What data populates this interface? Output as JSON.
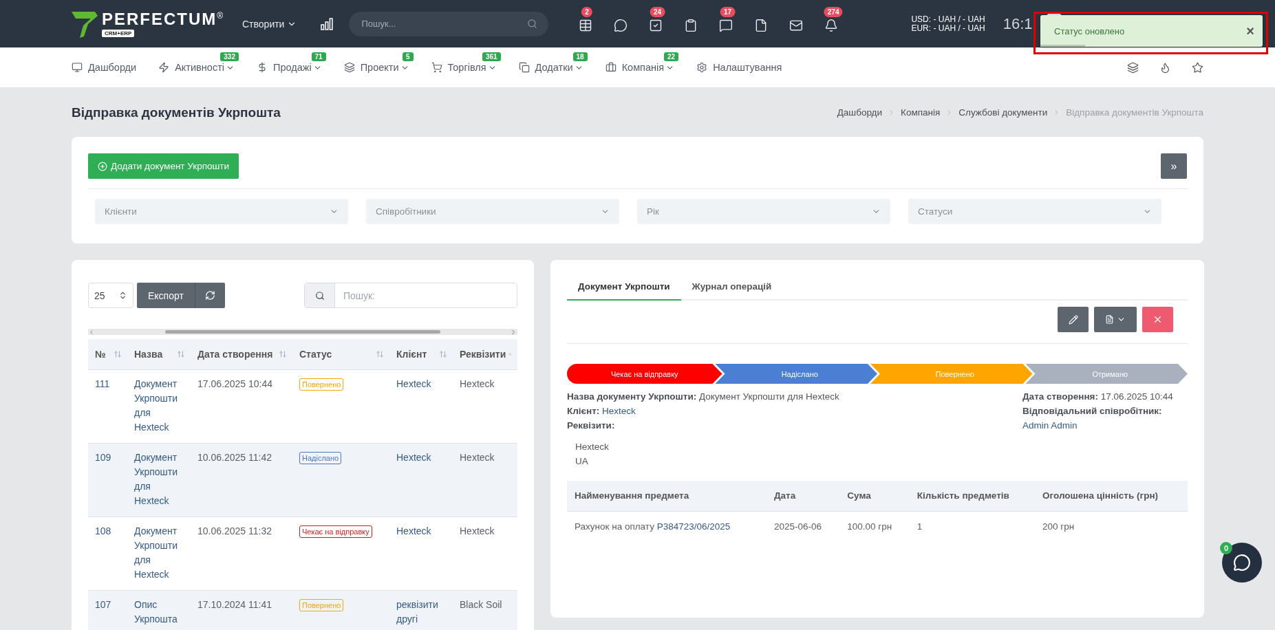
{
  "header": {
    "logo": {
      "name": "PERFECTUM",
      "mark": "®",
      "sub": "CRM+ERP"
    },
    "create": "Створити",
    "search": {
      "placeholder": "Пошук..."
    },
    "icons": [
      {
        "kind": "table",
        "badge": "2"
      },
      {
        "kind": "chat"
      },
      {
        "kind": "task",
        "badge": "24"
      },
      {
        "kind": "clipboard"
      },
      {
        "kind": "message",
        "badge": "17"
      },
      {
        "kind": "file"
      },
      {
        "kind": "mail"
      },
      {
        "kind": "bell",
        "badge": "274"
      }
    ],
    "currency": [
      "USD: - UAH / - UAH",
      "EUR: - UAH / - UAH"
    ],
    "time": "16:1"
  },
  "toast": {
    "text": "Статус оновлено",
    "close": "×",
    "level": 0.2
  },
  "nav": [
    {
      "kind": "monitor",
      "label": "Дашборди",
      "dropdown": false
    },
    {
      "kind": "zap",
      "label": "Активності",
      "badge": "332",
      "dropdown": true
    },
    {
      "kind": "dollar",
      "label": "Продажі",
      "badge": "71",
      "dropdown": true
    },
    {
      "kind": "layers",
      "label": "Проекти",
      "badge": "5",
      "dropdown": true
    },
    {
      "kind": "cart",
      "label": "Торгівля",
      "badge": "361",
      "dropdown": true
    },
    {
      "kind": "copy",
      "label": "Додатки",
      "badge": "18",
      "dropdown": true
    },
    {
      "kind": "briefcase",
      "label": "Компанія",
      "badge": "22",
      "dropdown": true
    },
    {
      "kind": "settings",
      "label": "Налаштування",
      "dropdown": false
    }
  ],
  "nav_right": [
    {
      "kind": "layers"
    },
    {
      "kind": "flame"
    },
    {
      "kind": "star"
    }
  ],
  "page_title": "Відправка документів Укрпошта",
  "breadcrumbs": [
    {
      "label": "Дашборди",
      "current": false
    },
    {
      "label": "Компанія",
      "current": false
    },
    {
      "label": "Службові документи",
      "current": false
    },
    {
      "label": "Відправка документів Укрпошта",
      "current": true
    }
  ],
  "add_button": "Додати документ Укрпошти",
  "expand_button": "»",
  "filters": [
    {
      "placeholder": "Клієнти"
    },
    {
      "placeholder": "Співробітники"
    },
    {
      "placeholder": "Рік"
    },
    {
      "placeholder": "Статуси"
    }
  ],
  "list": {
    "page_size": "25",
    "export": "Експорт",
    "search": {
      "placeholder": "Пошук:"
    },
    "columns": [
      "№",
      "Назва",
      "Дата створення",
      "Статус",
      "Клієнт",
      "Реквізити"
    ],
    "rows": [
      {
        "number": "111",
        "name": "Документ Укрпошти для Hexteck",
        "date": "17.06.2025 10:44",
        "status": "Повернено",
        "color": "#f6a609",
        "client": "Hexteck",
        "requisites": "Hexteck"
      },
      {
        "number": "109",
        "name": "Документ Укрпошти для Hexteck",
        "date": "10.06.2025 11:42",
        "status": "Надіслано",
        "color": "#4a78c2",
        "client": "Hexteck",
        "requisites": "Hexteck"
      },
      {
        "number": "108",
        "name": "Документ Укрпошти для Hexteck",
        "date": "10.06.2025 11:32",
        "status": "Чекає на відправку",
        "color": "#c81e1e",
        "client": "Hexteck",
        "requisites": "Hexteck"
      },
      {
        "number": "107",
        "name": "Опис Укрпошта",
        "date": "17.10.2024 11:41",
        "status": "Повернено",
        "color": "#f6a609",
        "client": "реквізити другі",
        "requisites": "Black Soil"
      }
    ]
  },
  "detail": {
    "tabs": [
      {
        "label": "Документ Укрпошти",
        "selected": true
      },
      {
        "label": "Журнал операцій",
        "selected": false
      }
    ],
    "steps": [
      {
        "label": "Чекає на відправку",
        "color": "#ff0000"
      },
      {
        "label": "Надіслано",
        "color": "#4a7fd4"
      },
      {
        "label": "Повернено",
        "color": "#ffa500"
      },
      {
        "label": "Отримано",
        "color": "#a9b1bf"
      }
    ],
    "fields_left": [
      {
        "label": "Назва документу Укрпошти:",
        "value": "Документ Укрпошти для Hexteck",
        "link": false
      },
      {
        "label": "Клієнт:",
        "value": "Hexteck",
        "link": true
      },
      {
        "label": "Реквізити:"
      }
    ],
    "requisites_lines": [
      "Hexteck",
      "UA"
    ],
    "created": {
      "label": "Дата створення:",
      "value": "17.06.2025 10:44"
    },
    "responsible": {
      "label": "Відповідальний співробітник:",
      "value": "Admin Admin"
    },
    "items_columns": [
      "Найменування предмета",
      "Дата",
      "Сума",
      "Кількість предметів",
      "Оголошена цінність (грн)"
    ],
    "items": [
      {
        "name": "Рахунок на оплату",
        "link": "Р384723/06/2025",
        "date": "2025-06-06",
        "sum": "100.00 грн",
        "count": "1",
        "value": "200 грн"
      }
    ]
  },
  "chat": {
    "badge": "0"
  }
}
